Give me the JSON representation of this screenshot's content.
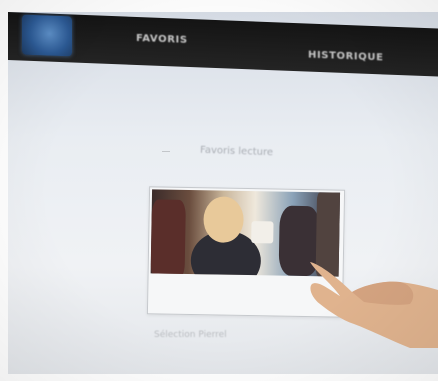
{
  "nav": {
    "tab_favoris": "FAVORIS",
    "tab_historique": "HISTORIQUE"
  },
  "content": {
    "section_title": "Favoris lecture",
    "card_caption": "Sélection Pierrel"
  },
  "colors": {
    "topbar": "#1c1c1c",
    "screen": "#e9edf2",
    "card_border": "#c6c9cd"
  }
}
